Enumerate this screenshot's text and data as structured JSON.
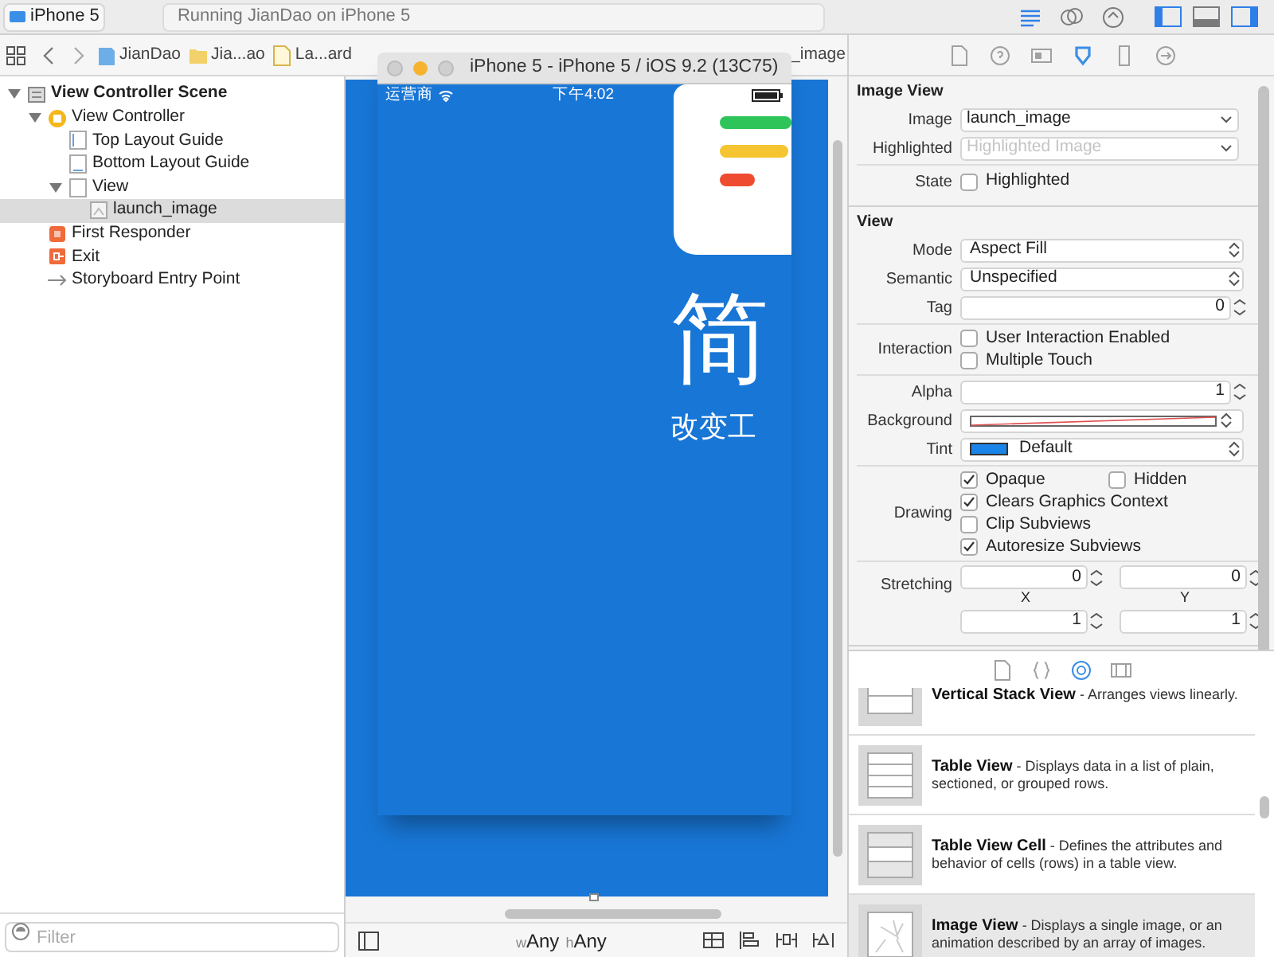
{
  "toolbar": {
    "scheme": "iPhone 5",
    "activity": "Running JianDao on iPhone 5",
    "editors": [
      {
        "kind": "standard",
        "selected": true
      },
      {
        "kind": "assistant",
        "selected": false
      },
      {
        "kind": "version",
        "selected": false
      }
    ],
    "panels": [
      {
        "kind": "navigator",
        "on": true
      },
      {
        "kind": "debug",
        "on": false
      },
      {
        "kind": "utilities",
        "on": true
      }
    ]
  },
  "breadcrumb": [
    {
      "label": "JianDao",
      "kind": "project"
    },
    {
      "label": "Jia...ao",
      "kind": "folder"
    },
    {
      "label": "La...ard",
      "kind": "storyboard"
    },
    {
      "label": "_image"
    }
  ],
  "outline": [
    {
      "label": "View Controller Scene",
      "kind": "scene",
      "selected": false,
      "expanded": true,
      "children": [
        {
          "label": "View Controller",
          "kind": "controller",
          "selected": false,
          "expanded": true,
          "children": [
            {
              "label": "Top Layout Guide",
              "kind": "top-guide",
              "selected": false
            },
            {
              "label": "Bottom Layout Guide",
              "kind": "bottom-guide",
              "selected": false
            },
            {
              "label": "View",
              "kind": "view",
              "selected": false,
              "expanded": true,
              "children": [
                {
                  "label": "launch_image",
                  "kind": "image",
                  "selected": true
                }
              ]
            }
          ]
        },
        {
          "label": "First Responder",
          "kind": "responder",
          "selected": false
        },
        {
          "label": "Exit",
          "kind": "exit",
          "selected": false
        },
        {
          "label": "Storyboard Entry Point",
          "kind": "entry",
          "selected": false
        }
      ]
    }
  ],
  "filter": {
    "placeholder": "Filter"
  },
  "size_class": [
    {
      "prefix": "w",
      "value": "Any"
    },
    {
      "prefix": "h",
      "value": "Any"
    }
  ],
  "simulator": {
    "title": "iPhone 5 - iPhone 5 / iOS 9.2 (13C75)",
    "carrier": "运营商",
    "time": "下午4:02",
    "headline": "简",
    "slogan": "改变工"
  },
  "inspector_tabs": [
    {
      "kind": "file",
      "selected": false
    },
    {
      "kind": "help",
      "selected": false
    },
    {
      "kind": "identity",
      "selected": false
    },
    {
      "kind": "attributes",
      "selected": true
    },
    {
      "kind": "size",
      "selected": false
    },
    {
      "kind": "connections",
      "selected": false
    }
  ],
  "inspector": [
    {
      "title": "Image View",
      "groups": [
        [
          {
            "kind": "combo",
            "label": "Image",
            "value": "launch_image"
          },
          {
            "kind": "combo",
            "label": "Highlighted",
            "placeholder": "Highlighted Image"
          }
        ],
        [
          {
            "kind": "checks",
            "label": "State",
            "lines": [
              [
                {
                  "label": "Highlighted",
                  "checked": false
                }
              ]
            ]
          }
        ]
      ]
    },
    {
      "title": "View",
      "groups": [
        [
          {
            "kind": "popup",
            "label": "Mode",
            "value": "Aspect Fill"
          },
          {
            "kind": "popup",
            "label": "Semantic",
            "value": "Unspecified"
          },
          {
            "kind": "number",
            "label": "Tag",
            "value": "0"
          }
        ],
        [
          {
            "kind": "checks",
            "label": "Interaction",
            "lines": [
              [
                {
                  "label": "User Interaction Enabled",
                  "checked": false
                }
              ],
              [
                {
                  "label": "Multiple Touch",
                  "checked": false
                }
              ]
            ]
          }
        ],
        [
          {
            "kind": "number",
            "label": "Alpha",
            "value": "1"
          },
          {
            "kind": "color",
            "label": "Background"
          },
          {
            "kind": "tint",
            "label": "Tint",
            "value": "Default"
          }
        ],
        [
          {
            "kind": "checks",
            "label": "Drawing",
            "lines": [
              [
                {
                  "label": "Opaque",
                  "checked": true
                },
                {
                  "label": "Hidden",
                  "checked": false
                }
              ],
              [
                {
                  "label": "Clears Graphics Context",
                  "checked": true
                }
              ],
              [
                {
                  "label": "Clip Subviews",
                  "checked": false
                }
              ],
              [
                {
                  "label": "Autoresize Subviews",
                  "checked": true
                }
              ]
            ]
          }
        ],
        [
          {
            "kind": "pair",
            "label": "Stretching",
            "fields": [
              {
                "value": "0",
                "caption": "X"
              },
              {
                "value": "0",
                "caption": "Y"
              }
            ]
          },
          {
            "kind": "pair",
            "fields": [
              {
                "value": "1"
              },
              {
                "value": "1"
              }
            ]
          }
        ]
      ]
    }
  ],
  "library_tabs": [
    {
      "kind": "file",
      "selected": false
    },
    {
      "kind": "code",
      "selected": false
    },
    {
      "kind": "object",
      "selected": true
    },
    {
      "kind": "media",
      "selected": false
    }
  ],
  "library": [
    {
      "title": "Vertical Stack View",
      "description": "- Arranges views linearly.",
      "kind": "stack",
      "selected": false
    },
    {
      "title": "Table View",
      "description": "- Displays data in a list of plain, sectioned, or grouped rows.",
      "kind": "table",
      "selected": false
    },
    {
      "title": "Table View Cell",
      "description": "- Defines the attributes and behavior of cells (rows) in a table view.",
      "kind": "cell",
      "selected": false
    },
    {
      "title": "Image View",
      "description": "- Displays a single image, or an animation described by an array of images.",
      "kind": "image",
      "selected": true
    }
  ]
}
